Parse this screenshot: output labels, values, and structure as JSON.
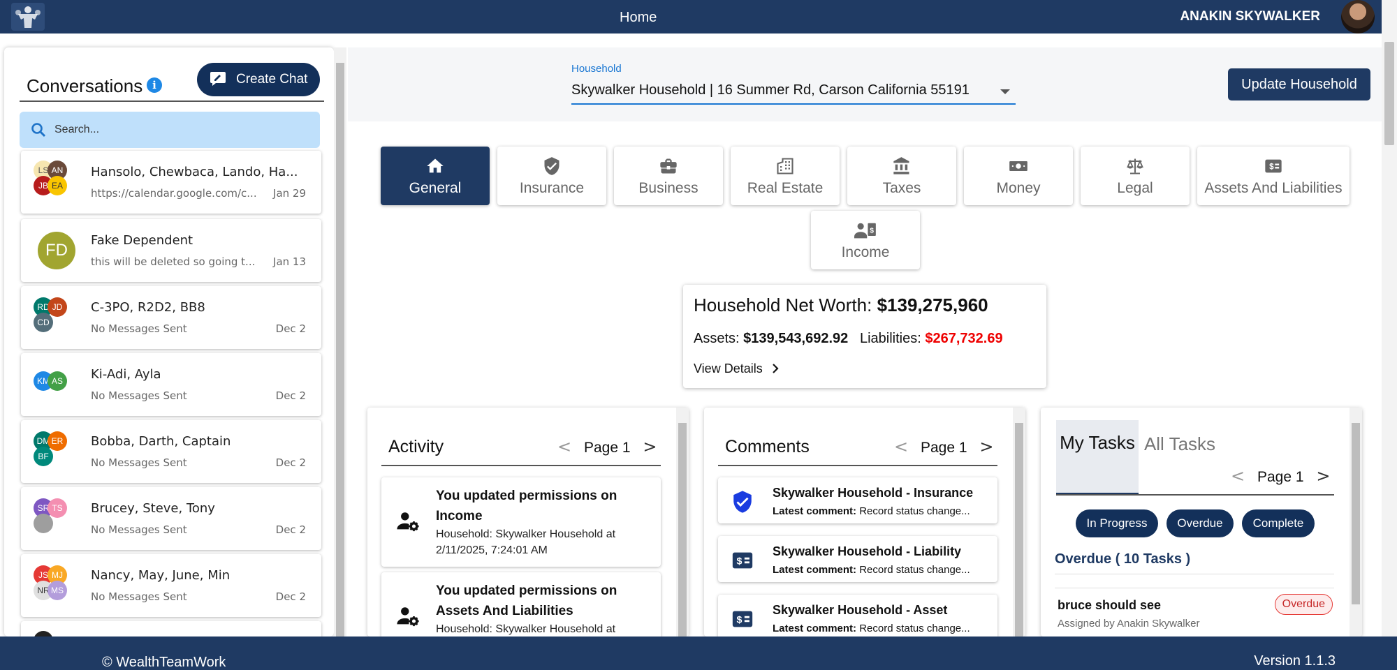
{
  "nav": {
    "title": "Home",
    "user_name": "ANAKIN SKYWALKER"
  },
  "footer": {
    "copyright": "© WealthTeamWork",
    "version": "Version 1.1.3"
  },
  "conversations": {
    "title": "Conversations",
    "create_label": "Create Chat",
    "search_placeholder": "Search...",
    "items": [
      {
        "name": "Hansolo, Chewbaca, Lando, Ha...",
        "preview": "https://calendar.google.com/c...",
        "date": "Jan 29",
        "avatars": [
          "LS",
          "AN",
          "JB",
          "EA"
        ]
      },
      {
        "name": "Fake Dependent",
        "preview": "this will be deleted so going t...",
        "date": "Jan 13",
        "avatars": [
          "FD"
        ]
      },
      {
        "name": "C-3PO, R2D2, BB8",
        "preview": "No Messages Sent",
        "date": "Dec 2",
        "avatars": [
          "RD",
          "JD",
          "CD"
        ]
      },
      {
        "name": "Ki-Adi, Ayla",
        "preview": "No Messages Sent",
        "date": "Dec 2",
        "avatars": [
          "KM",
          "AS"
        ]
      },
      {
        "name": "Bobba, Darth, Captain",
        "preview": "No Messages Sent",
        "date": "Dec 2",
        "avatars": [
          "DM",
          "ER",
          "BF"
        ]
      },
      {
        "name": "Brucey, Steve, Tony",
        "preview": "No Messages Sent",
        "date": "Dec 2",
        "avatars": [
          "SR",
          "TS"
        ]
      },
      {
        "name": "Nancy, May, June, Min",
        "preview": "No Messages Sent",
        "date": "Dec 2",
        "avatars": [
          "JS",
          "MJ",
          "NR",
          "MS"
        ]
      }
    ]
  },
  "household": {
    "label": "Household",
    "value": "Skywalker Household | 16 Summer Rd, Carson California 55191",
    "update_label": "Update Household"
  },
  "tabs": [
    {
      "label": "General",
      "icon": "home-icon"
    },
    {
      "label": "Insurance",
      "icon": "shield-icon"
    },
    {
      "label": "Business",
      "icon": "briefcase-icon"
    },
    {
      "label": "Real Estate",
      "icon": "building-icon"
    },
    {
      "label": "Taxes",
      "icon": "bank-icon"
    },
    {
      "label": "Money",
      "icon": "cash-icon"
    },
    {
      "label": "Legal",
      "icon": "scale-icon"
    },
    {
      "label": "Assets And Liabilities",
      "icon": "dollar-box-icon"
    },
    {
      "label": "Income",
      "icon": "contact-money-icon"
    }
  ],
  "net_worth": {
    "label": "Household Net Worth:",
    "value": "$139,275,960",
    "assets_label": "Assets:",
    "assets_value": "$139,543,692.92",
    "liabilities_label": "Liabilities:",
    "liabilities_value": "$267,732.69",
    "view_details": "View Details"
  },
  "activity": {
    "title": "Activity",
    "page": "Page 1",
    "items": [
      {
        "title": "You updated permissions on Income",
        "detail": "Household: Skywalker Household at 2/11/2025, 7:24:01 AM"
      },
      {
        "title": "You updated permissions on Assets And Liabilities",
        "detail": "Household: Skywalker Household at"
      }
    ]
  },
  "comments": {
    "title": "Comments",
    "page": "Page 1",
    "latest_label": "Latest comment:",
    "items": [
      {
        "title": "Skywalker Household - Insurance",
        "comment": "Record status change..."
      },
      {
        "title": "Skywalker Household - Liability",
        "comment": "Record status change..."
      },
      {
        "title": "Skywalker Household - Asset",
        "comment": "Record status change..."
      }
    ]
  },
  "tasks": {
    "tab_my": "My Tasks",
    "tab_all": "All Tasks",
    "page": "Page 1",
    "filters": [
      "In Progress",
      "Overdue",
      "Complete"
    ],
    "overdue_heading": "Overdue ( 10 Tasks )",
    "items": [
      {
        "name": "bruce should see",
        "assigned": "Assigned by Anakin Skywalker",
        "status": "Overdue"
      }
    ]
  },
  "colors": {
    "navy": "#1f3a63",
    "accent_blue": "#1976d2",
    "danger": "#e00000",
    "search_bg": "#bfe0fb"
  }
}
